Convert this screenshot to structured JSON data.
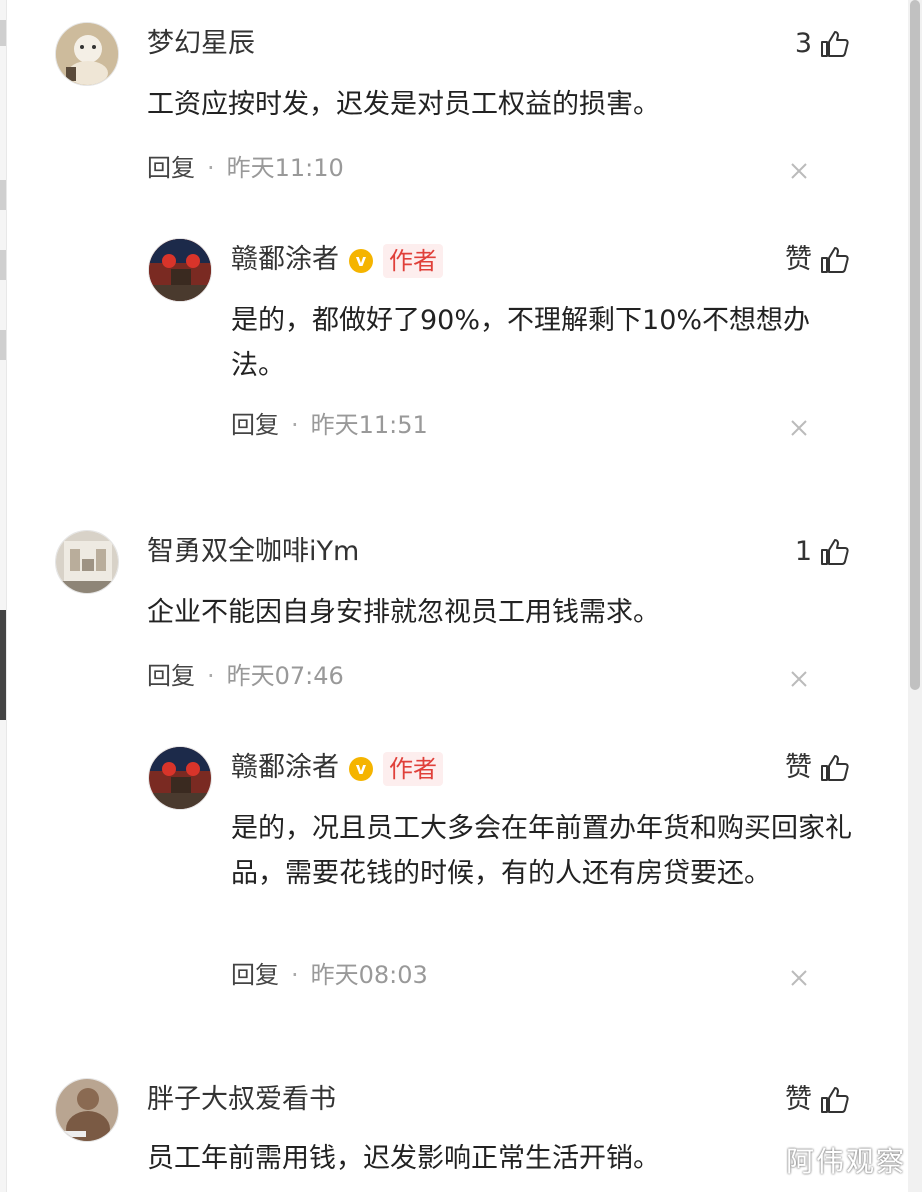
{
  "comments": [
    {
      "user": "梦幻星辰",
      "text": "工资应按时发，迟发是对员工权益的损害。",
      "reply_label": "回复",
      "time": "昨天11:10",
      "likes": "3",
      "reply": {
        "user": "赣鄱涂者",
        "badge": "作者",
        "text": "是的，都做好了90%，不理解剩下10%不想想办法。",
        "reply_label": "回复",
        "time": "昨天11:51",
        "likes": "赞"
      }
    },
    {
      "user": "智勇双全咖啡iYm",
      "text": "企业不能因自身安排就忽视员工用钱需求。",
      "reply_label": "回复",
      "time": "昨天07:46",
      "likes": "1",
      "reply": {
        "user": "赣鄱涂者",
        "badge": "作者",
        "text": "是的，况且员工大多会在年前置办年货和购买回家礼品，需要花钱的时候，有的人还有房贷要还。",
        "reply_label": "回复",
        "time": "昨天08:03",
        "likes": "赞"
      }
    },
    {
      "user": "胖子大叔爱看书",
      "text": "员工年前需用钱，迟发影响正常生活开销。",
      "likes": "赞"
    }
  ],
  "watermark": "阿伟观察",
  "colors": {
    "badge_text": "#e0403a",
    "badge_bg": "#fdeeee",
    "verify": "#f5b400",
    "meta": "#999999"
  },
  "icons": [
    "thumbs-up-icon",
    "close-icon",
    "verified-icon"
  ]
}
